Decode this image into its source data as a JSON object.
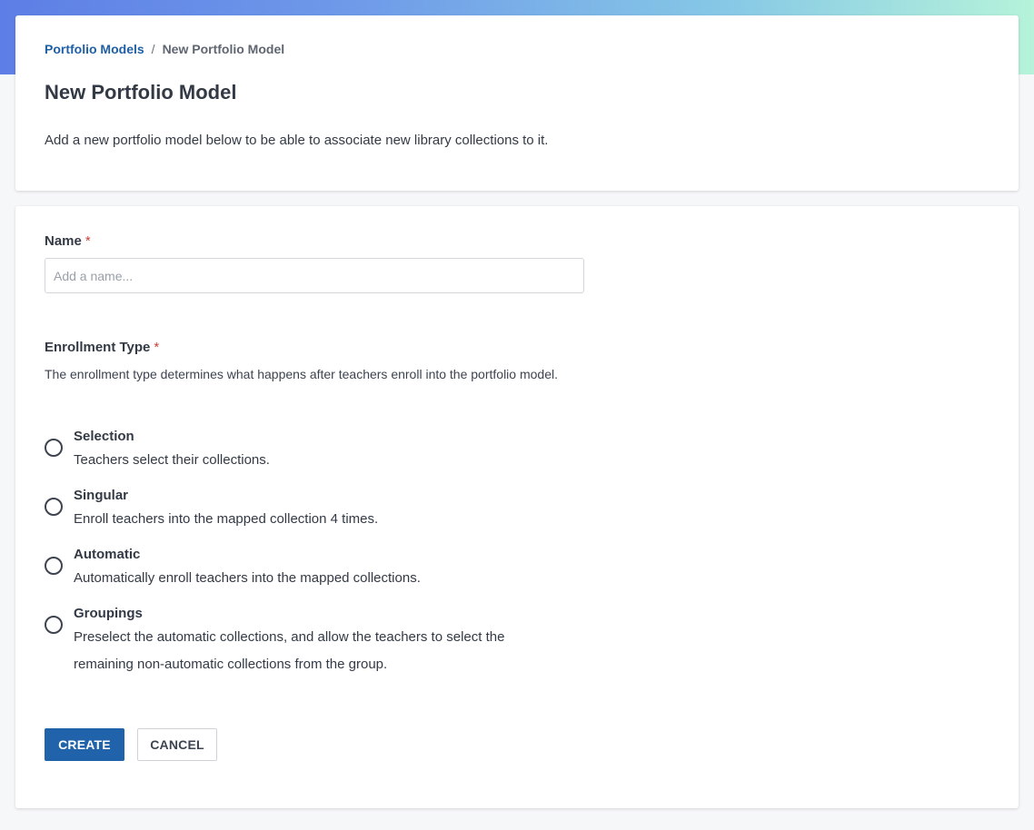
{
  "breadcrumb": {
    "parent": "Portfolio Models",
    "separator": "/",
    "current": "New Portfolio Model"
  },
  "header": {
    "title": "New Portfolio Model",
    "description": "Add a new portfolio model below to be able to associate new library collections to it."
  },
  "form": {
    "name_label": "Name",
    "required_mark": "*",
    "name_value": "",
    "name_placeholder": "Add a name...",
    "enrollment_label": "Enrollment Type",
    "enrollment_help": "The enrollment type determines what happens after teachers enroll into the portfolio model.",
    "enrollment_options": [
      {
        "title": "Selection",
        "description": "Teachers select their collections.",
        "selected": false
      },
      {
        "title": "Singular",
        "description": "Enroll teachers into the mapped collection 4 times.",
        "selected": false
      },
      {
        "title": "Automatic",
        "description": "Automatically enroll teachers into the mapped collections.",
        "selected": false
      },
      {
        "title": "Groupings",
        "description": "Preselect the automatic collections, and allow the teachers to select the remaining non-automatic collections from the group.",
        "selected": false
      }
    ]
  },
  "actions": {
    "create_label": "CREATE",
    "cancel_label": "CANCEL"
  },
  "colors": {
    "primary": "#2063ab",
    "link": "#1f5fa6",
    "required": "#d0403a",
    "text": "#333a45"
  }
}
